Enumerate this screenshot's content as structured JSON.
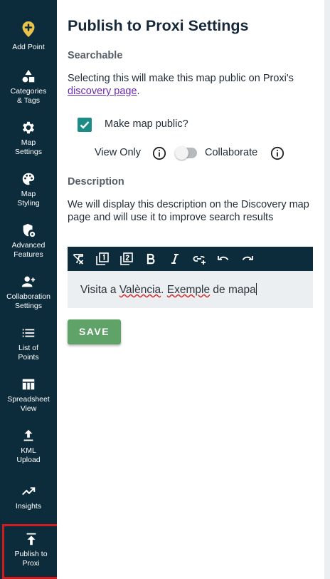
{
  "sidebar": {
    "items": [
      {
        "label": "Add Point",
        "icon": "add-point-icon"
      },
      {
        "label": "Categories\n& Tags",
        "icon": "shapes-icon"
      },
      {
        "label": "Map\nSettings",
        "icon": "gear-icon"
      },
      {
        "label": "Map\nStyling",
        "icon": "palette-icon"
      },
      {
        "label": "Advanced\nFeatures",
        "icon": "shield-settings-icon"
      },
      {
        "label": "Collaboration\nSettings",
        "icon": "person-add-icon"
      },
      {
        "label": "List of\nPoints",
        "icon": "list-icon"
      },
      {
        "label": "Spreadsheet\nView",
        "icon": "table-icon"
      },
      {
        "label": "KML\nUpload",
        "icon": "upload-icon"
      },
      {
        "label": "Insights",
        "icon": "trending-up-icon"
      },
      {
        "label": "Publish to\nProxi",
        "icon": "publish-icon"
      }
    ],
    "active_index": 10,
    "colors": {
      "background": "#0d2c3b",
      "active_border": "#d41a1a",
      "add_point_accent": "#e8c24a"
    }
  },
  "main": {
    "title": "Publish to Proxi Settings",
    "searchable_heading": "Searchable",
    "searchable_text_before": "Selecting this will make this map public on Proxi's ",
    "searchable_link": "discovery page",
    "searchable_text_after": ".",
    "make_public_label": "Make map public?",
    "make_public_checked": true,
    "view_only_label": "View Only",
    "collaborate_label": "Collaborate",
    "collaborate_enabled": false,
    "description_heading": "Description",
    "description_help": "We will display this description on the Discovery map page and will use it to improve search results",
    "editor": {
      "toolbar": [
        "clear-format-icon",
        "heading-1-icon",
        "heading-2-icon",
        "bold-icon",
        "italic-icon",
        "link-icon",
        "undo-icon",
        "redo-icon"
      ],
      "text_part1": "Visita a ",
      "text_word1": "València",
      "text_part2": ". ",
      "text_word2": "Exemple",
      "text_part3": " de mapa"
    },
    "save_label": "SAVE",
    "colors": {
      "checkbox": "#1b8c86",
      "link": "#6a2cb0",
      "save": "#5fa369"
    }
  }
}
